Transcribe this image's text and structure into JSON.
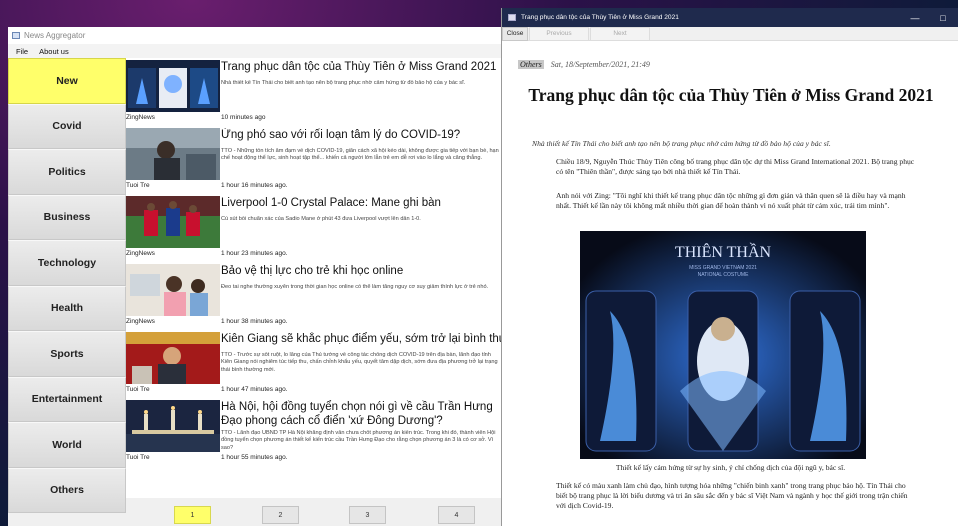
{
  "left_window": {
    "title": "News Aggregator",
    "menu": [
      "File",
      "About us"
    ]
  },
  "categories": [
    "New",
    "Covid",
    "Politics",
    "Business",
    "Technology",
    "Health",
    "Sports",
    "Entertainment",
    "World",
    "Others"
  ],
  "active_category": "New",
  "articles": [
    {
      "title": "Trang phục dân tộc của Thùy Tiên ở Miss Grand 2021",
      "snippet": "Nhà thiết kế Tín Thái cho biết anh tạo nên bộ trang phục nhờ cảm hứng từ đồ bảo hộ của y bác sĩ.",
      "source": "ZingNews",
      "time": "10 minutes ago"
    },
    {
      "title": "Ứng phó sao với rối loạn tâm lý do COVID-19?",
      "snippet": "TTO - Những tồn tích âm đạm về dịch COVID-19, giãn cách xã hội kéo dài, không được gia tiếp với bạn bè, hạn chế hoạt động thể lực, sinh hoạt tập thể... khiến cả người lớn lẫn trẻ em dễ rơi vào lo lắng và căng thẳng.",
      "source": "Tuoi Tre",
      "time": "1 hour 16 minutes ago."
    },
    {
      "title": "Liverpool 1-0 Crystal Palace: Mane ghi bàn",
      "snippet": "Cú sút bồi chuẩn xác của Sadio Mane ở phút 43 đưa Liverpool vượt lên dẫn 1-0.",
      "source": "ZingNews",
      "time": "1 hour 23 minutes ago."
    },
    {
      "title": "Bảo vệ thị lực cho trẻ khi học online",
      "snippet": "Đeo tai nghe thường xuyên trong thời gian học online có thể làm tăng nguy cơ suy giảm thính lực ở trẻ nhỏ.",
      "source": "ZingNews",
      "time": "1 hour 38 minutes ago."
    },
    {
      "title": "Kiên Giang sẽ khắc phục điểm yếu, sớm trở lại bình thường",
      "snippet": "TTO - Trước sự sốt ruột, lo lắng của Thủ tướng về công tác chống dịch COVID-19 trên địa bàn, lãnh đạo tỉnh Kiên Giang nói nghiêm túc tiếp thu, chấn chỉnh khẩu yếu, quyết tâm dập dịch, sớm đưa địa phương trở lại trạng thái bình thường mới.",
      "source": "Tuoi Tre",
      "time": "1 hour 47 minutes ago."
    },
    {
      "title": "Hà Nội, hội đồng tuyển chọn nói gì về cầu Trần Hưng Đạo phong cách cổ điển 'xứ Đông Dương'?",
      "snippet": "TTO - Lãnh đạo UBND TP Hà Nội khẳng định vẫn chưa chốt phương án kiến trúc. Trong khi đó, thành viên Hội đồng tuyển chọn phương án thiết kế kiến trúc cầu Trần Hưng Đạo cho rằng chọn phương án 3 là có cơ sở. Vì sao?",
      "source": "Tuoi Tre",
      "time": "1 hour 55 minutes ago."
    }
  ],
  "pages": [
    "1",
    "2",
    "3",
    "4"
  ],
  "active_page": "1",
  "right_window": {
    "title": "Trang phục dân tộc của Thùy Tiên ở Miss Grand 2021",
    "buttons": {
      "close": "Close",
      "previous": "Previous",
      "next": "Next"
    },
    "article": {
      "category": "Others",
      "date": "Sat, 18/September/2021, 21:49",
      "headline": "Trang phục dân tộc của Thùy Tiên ở Miss Grand 2021",
      "lead": "Nhà thiết kế Tín Thái cho biết anh tạo nên bộ trang phục nhờ cảm hứng từ đồ bảo hộ của y bác sĩ.",
      "para1": "Chiều 18/9, Nguyễn Thúc Thùy Tiên công bố trang phục dân tộc dự thi Miss Grand International 2021. Bộ trang phục có tên \"Thiên thần\", được sáng tạo bởi nhà thiết kế Tín Thái.",
      "para2": "Anh nói với Zing: \"Tôi nghĩ khi thiết kế trang phục dân tộc những gì đơn giản và thân quen sẽ là điều hay và mạnh nhất. Thiết kế lần này tôi không mất nhiều thời gian để hoàn thành vì nó xuất phát từ cảm xúc, trái tim mình\".",
      "figure_title": "THIÊN THẦN",
      "figure_sub1": "MISS GRAND VIETNAM 2021",
      "figure_sub2": "NATIONAL COSTUME",
      "caption": "Thiết kế lấy cảm hứng từ sự hy sinh, ý chí chống dịch của đội ngũ y, bác sĩ.",
      "para3": "Thiết kế có màu xanh làm chủ đạo, hình tượng hóa những \"chiến binh xanh\" trong trang phục bảo hộ. Tín Thái cho biết bộ trang phục là lời biểu dương và tri ân sâu sắc đến y bác sĩ Việt Nam và ngành y học thế giới trong trận chiến với dịch Covid-19."
    }
  }
}
